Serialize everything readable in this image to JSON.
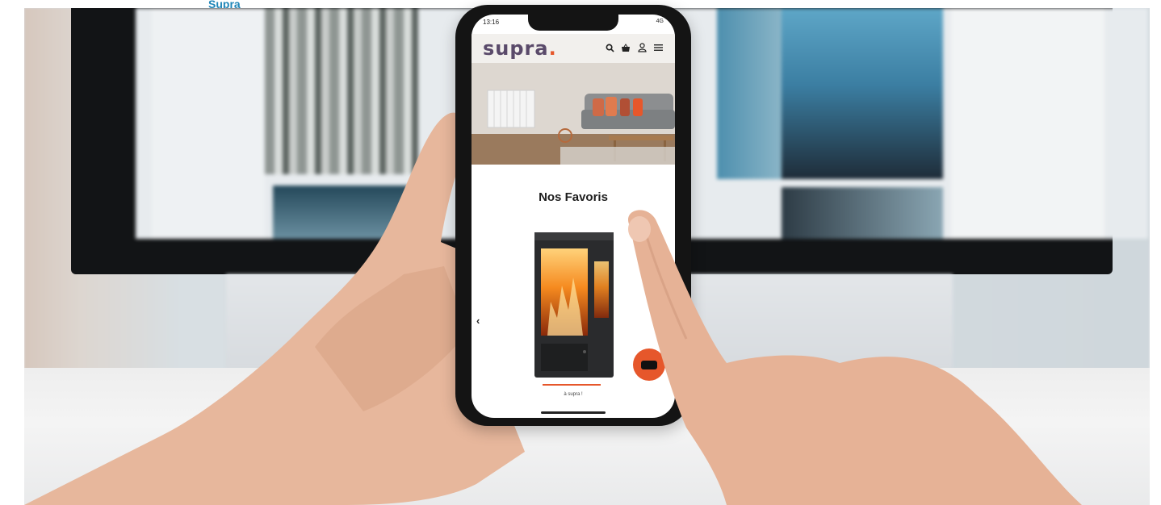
{
  "background": {
    "blue_text": "Supra"
  },
  "phone": {
    "status": {
      "time": "13:16",
      "network": "4G"
    },
    "nav": {
      "logo_text": "supra",
      "logo_dot": ".",
      "icons": [
        "search-icon",
        "basket-icon",
        "user-icon",
        "menu-icon"
      ]
    },
    "main": {
      "section_title": "Nos Favoris",
      "prev_glyph": "‹",
      "caption": "à supra !"
    }
  },
  "colors": {
    "accent": "#e6572b",
    "logo": "#5a4a6a"
  }
}
